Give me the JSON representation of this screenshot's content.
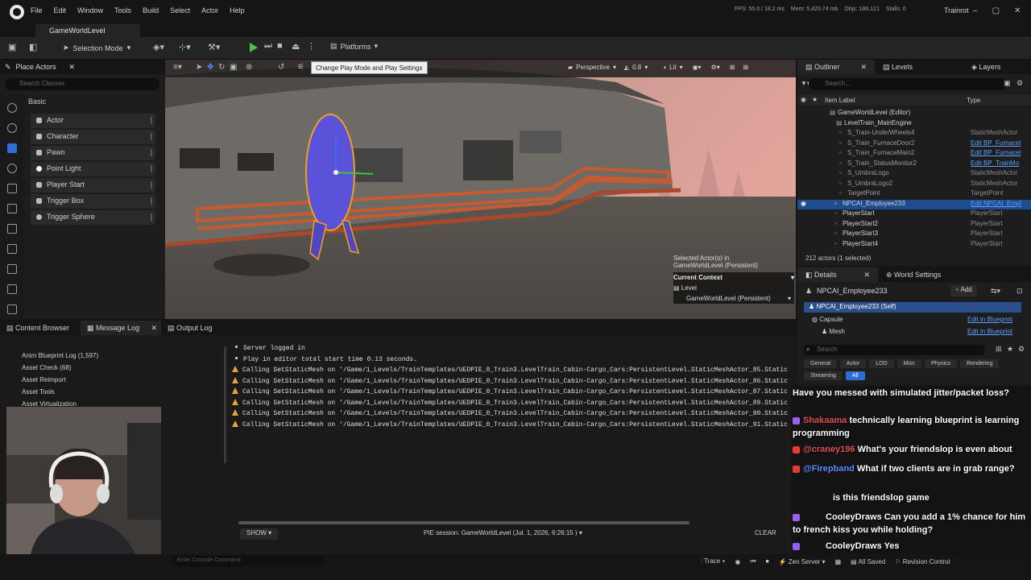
{
  "menu": [
    "File",
    "Edit",
    "Window",
    "Tools",
    "Build",
    "Select",
    "Actor",
    "Help"
  ],
  "stats": {
    "fps": "FPS: 55.0 / 18.2 ms",
    "mem": "Mem: 5,420.74 mb",
    "objs": "Objs: 186,121",
    "stalls": "Stalls: 0"
  },
  "project_name": "Trainrot",
  "level_tab": "GameWorldLevel",
  "toolbar": {
    "selection_mode": "Selection Mode",
    "platforms": "Platforms",
    "tooltip": "Change Play Mode and Play Settings"
  },
  "place_actors": {
    "title": "Place Actors",
    "search_placeholder": "Search Classes",
    "section": "Basic",
    "items": [
      "Actor",
      "Character",
      "Pawn",
      "Point Light",
      "Player Start",
      "Trigger Box",
      "Trigger Sphere"
    ]
  },
  "viewport": {
    "perspective": "Perspective",
    "speed": "0.8",
    "lit": "Lit",
    "selected_line1": "Selected Actor(s) in",
    "selected_line2": "GameWorldLevel (Persistent)",
    "current_context": "Current Context",
    "level_label": "Level",
    "level_value": "GameWorldLevel (Persistent)"
  },
  "outliner": {
    "tabs": [
      "Outliner",
      "Levels",
      "Layers"
    ],
    "search_placeholder": "Search...",
    "col_label": "Item Label",
    "col_type": "Type",
    "rows": [
      {
        "label": "GameWorldLevel (Editor)",
        "type": ""
      },
      {
        "label": "LevelTrain_MainEngine",
        "type": ""
      },
      {
        "label": "S_Train-UnderWheels4",
        "type": "StaticMeshActor"
      },
      {
        "label": "S_Train_FurnaceDoor2",
        "type": "Edit BP_Furnacel"
      },
      {
        "label": "S_Train_FurnaceMain2",
        "type": "Edit BP_Furnacel"
      },
      {
        "label": "S_Train_StatusMonitor2",
        "type": "Edit BP_TrainMo"
      },
      {
        "label": "S_UmbraLogo",
        "type": "StaticMeshActor"
      },
      {
        "label": "S_UmbraLogo2",
        "type": "StaticMeshActor"
      },
      {
        "label": "TargetPoint",
        "type": "TargetPoint"
      },
      {
        "label": "NPCAI_Employee233",
        "type": "Edit NPCAI_Empl"
      },
      {
        "label": "PlayerStart",
        "type": "PlayerStart"
      },
      {
        "label": "PlayerStart2",
        "type": "PlayerStart"
      },
      {
        "label": "PlayerStart3",
        "type": "PlayerStart"
      },
      {
        "label": "PlayerStart4",
        "type": "PlayerStart"
      }
    ],
    "actor_count": "212 actors (1 selected)"
  },
  "details": {
    "tabs": [
      "Details",
      "World Settings"
    ],
    "actor_name": "NPCAI_Employee233",
    "add_label": "Add",
    "self_row": "NPCAI_Employee233 (Self)",
    "components": [
      "Capsule",
      "Mesh"
    ],
    "edit_bp": "Edit in Blueprint",
    "search_placeholder": "Search",
    "categories": [
      "General",
      "Actor",
      "LOD",
      "Misc",
      "Physics",
      "Rendering",
      "Streaming",
      "All"
    ]
  },
  "chat": [
    {
      "user": "",
      "text": "Have you messed with simulated jitter/packet loss?"
    },
    {
      "user": "Shakaama",
      "text": "technically learning blueprint is learning programming"
    },
    {
      "user": "@craney196",
      "text": "What's your friendslop is even about"
    },
    {
      "user": "@Firepband",
      "text": "What if two clients are in grab range?"
    },
    {
      "user": "",
      "text": "is this friendslop game"
    },
    {
      "user": "CooleyDraws",
      "text": "Can you add a 1% chance for him to french kiss you while holding?"
    },
    {
      "user": "CooleyDraws",
      "text": "Yes"
    }
  ],
  "bottom": {
    "tabs": [
      "Content Browser",
      "Message Log",
      "Output Log"
    ],
    "categories": [
      "Anim Blueprint Log (1,597)",
      "Asset Check (68)",
      "Asset Reimport",
      "Asset Tools",
      "Asset Virtualization"
    ],
    "log": [
      {
        "level": "info",
        "text": "Server logged in"
      },
      {
        "level": "info",
        "text": "Play in editor total start time 0.13 seconds."
      },
      {
        "level": "warn",
        "text": "Calling SetStaticMesh on '/Game/1_Levels/TrainTemplates/UEDPIE_0_Train3.LevelTrain_Cabin-Cargo_Cars:PersistentLevel.StaticMeshActor_85.StaticMeshCom"
      },
      {
        "level": "warn",
        "text": "Calling SetStaticMesh on '/Game/1_Levels/TrainTemplates/UEDPIE_0_Train3.LevelTrain_Cabin-Cargo_Cars:PersistentLevel.StaticMeshActor_86.StaticMeshCom"
      },
      {
        "level": "warn",
        "text": "Calling SetStaticMesh on '/Game/1_Levels/TrainTemplates/UEDPIE_0_Train3.LevelTrain_Cabin-Cargo_Cars:PersistentLevel.StaticMeshActor_87.StaticMeshCom"
      },
      {
        "level": "warn",
        "text": "Calling SetStaticMesh on '/Game/1_Levels/TrainTemplates/UEDPIE_0_Train3.LevelTrain_Cabin-Cargo_Cars:PersistentLevel.StaticMeshActor_89.StaticMeshCom"
      },
      {
        "level": "warn",
        "text": "Calling SetStaticMesh on '/Game/1_Levels/TrainTemplates/UEDPIE_0_Train3.LevelTrain_Cabin-Cargo_Cars:PersistentLevel.StaticMeshActor_90.StaticMeshCom"
      },
      {
        "level": "warn",
        "text": "Calling SetStaticMesh on '/Game/1_Levels/TrainTemplates/UEDPIE_0_Train3.LevelTrain_Cabin-Cargo_Cars:PersistentLevel.StaticMeshActor_91.StaticMeshCom"
      }
    ],
    "show_label": "SHOW",
    "pie_session": "PIE session: GameWorldLevel (Jul. 1, 2026, 6:26:15 )",
    "clear_label": "CLEAR"
  },
  "statusbar": {
    "console_placeholder": "Enter Console Command",
    "trace": "Trace",
    "zen": "Zen Server",
    "saved": "All Saved",
    "revision": "Revision Control"
  },
  "colors": {
    "accent": "#2c6ed6",
    "play": "#4cc04c",
    "selection": "#1e4c8c",
    "warning": "#e8a330",
    "link": "#5aa0ff"
  }
}
